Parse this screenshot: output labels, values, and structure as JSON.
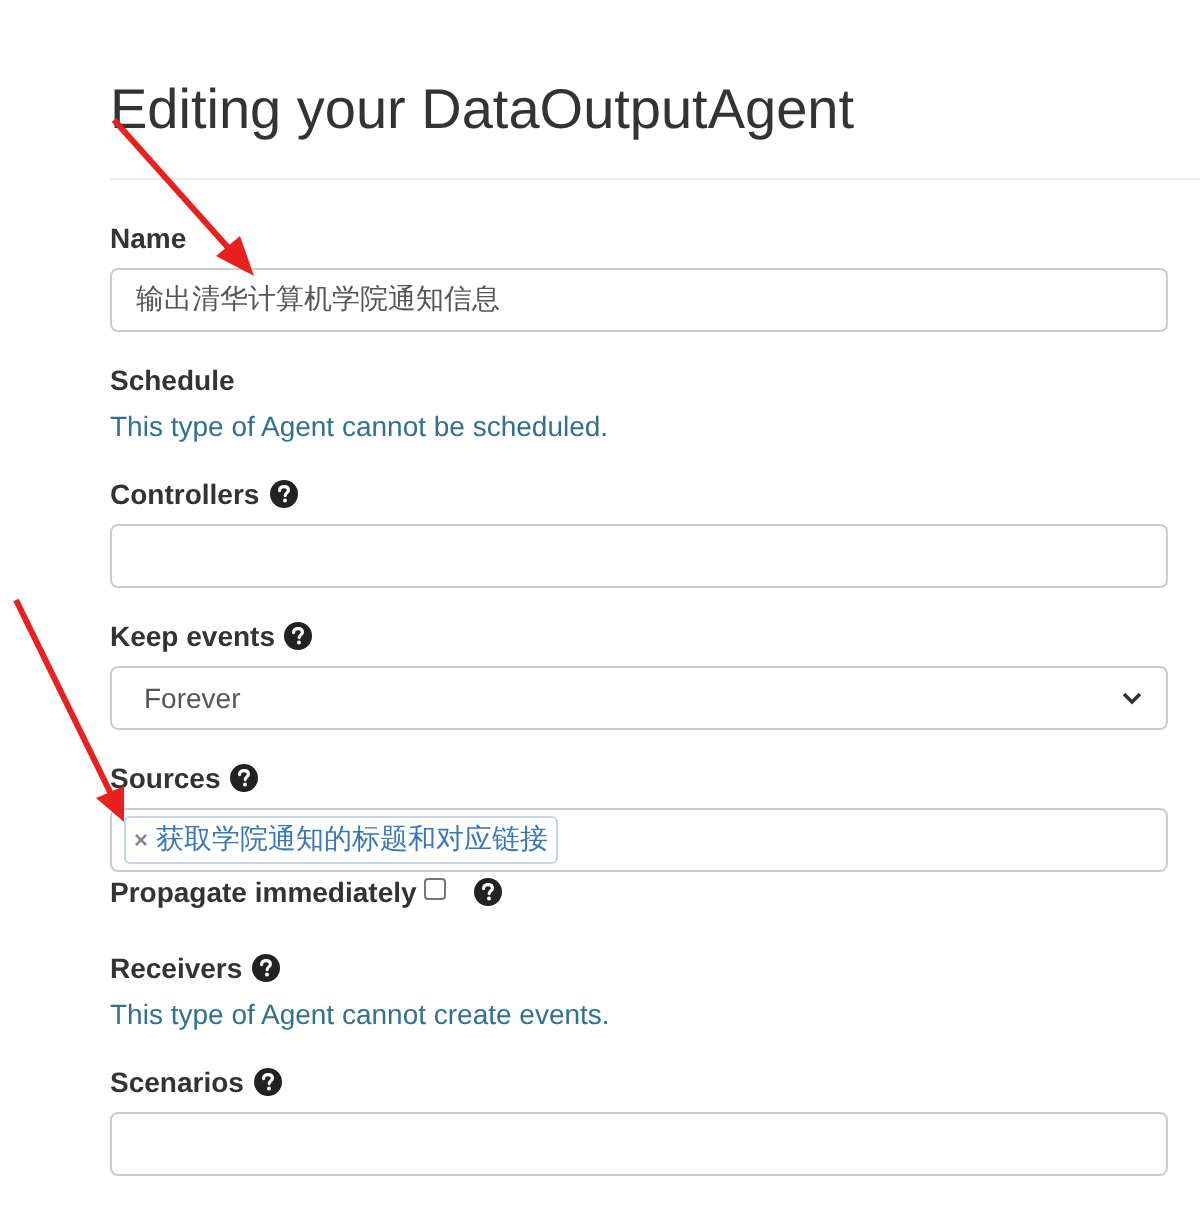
{
  "title": "Editing your DataOutputAgent",
  "fields": [
    {
      "kind": "text",
      "label": "Name",
      "help": false,
      "value": "输出清华计算机学院通知信息"
    },
    {
      "kind": "info",
      "label": "Schedule",
      "help": false,
      "text": "This type of Agent cannot be scheduled."
    },
    {
      "kind": "text",
      "label": "Controllers",
      "help": true
    },
    {
      "kind": "select",
      "label": "Keep events",
      "help": true,
      "value": "Forever"
    },
    {
      "kind": "tags",
      "label": "Sources",
      "help": true,
      "tags": [
        {
          "remove": "×",
          "text": "获取学院通知的标题和对应链接"
        }
      ]
    },
    {
      "kind": "checkbox",
      "label": "Propagate immediately",
      "help": true,
      "checked": false
    },
    {
      "kind": "info",
      "label": "Receivers",
      "help": true,
      "text": "This type of Agent cannot create events."
    },
    {
      "kind": "text",
      "label": "Scenarios",
      "help": true
    }
  ]
}
